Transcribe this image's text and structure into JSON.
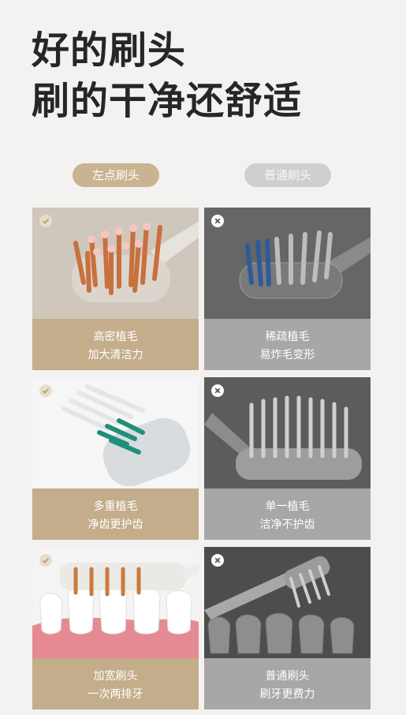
{
  "headline": {
    "line1": "好的刷头",
    "line2": "刷的干净还舒适"
  },
  "compare": {
    "left_label": "左点刷头",
    "right_label": "普通刷头"
  },
  "rows": [
    {
      "left": {
        "line1": "高密植毛",
        "line2": "加大清洁力"
      },
      "right": {
        "line1": "稀疏植毛",
        "line2": "易炸毛变形"
      }
    },
    {
      "left": {
        "line1": "多重植毛",
        "line2": "净齿更护齿"
      },
      "right": {
        "line1": "单一植毛",
        "line2": "洁净不护齿"
      }
    },
    {
      "left": {
        "line1": "加宽刷头",
        "line2": "一次两排牙"
      },
      "right": {
        "line1": "普通刷头",
        "line2": "刷牙更费力"
      }
    }
  ],
  "icons": {
    "good": "check-icon",
    "bad": "close-icon"
  },
  "colors": {
    "good_caption": "#c4ad8b",
    "bad_caption": "#a7a7a7",
    "good_pill": "#c9b391",
    "bad_pill": "#cfcfcf"
  }
}
